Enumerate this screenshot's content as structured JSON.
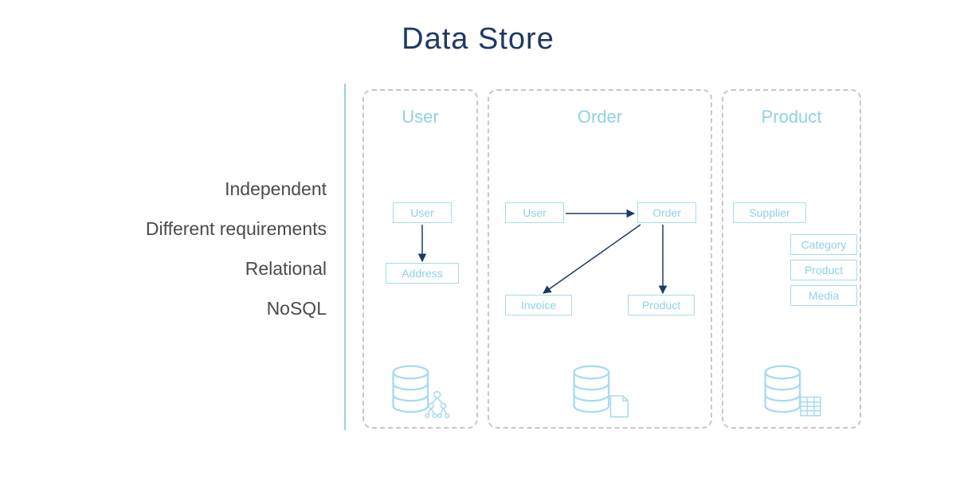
{
  "title": "Data Store",
  "attributes": {
    "a1": "Independent",
    "a2": "Different requirements",
    "a3": "Relational",
    "a4": "NoSQL"
  },
  "panels": {
    "user": {
      "title": "User"
    },
    "order": {
      "title": "Order"
    },
    "product": {
      "title": "Product"
    }
  },
  "boxes": {
    "u_user": "User",
    "u_address": "Address",
    "o_user": "User",
    "o_order": "Order",
    "o_invoice": "Invoice",
    "o_product": "Product",
    "p_supplier": "Supplier",
    "p_category": "Category",
    "p_product": "Product",
    "p_media": "Media"
  },
  "colors": {
    "accent": "#8ed1e8",
    "border": "#a8dbee",
    "text": "#4a4a4a",
    "title": "#1c3a63",
    "arrow": "#1c3a63"
  }
}
